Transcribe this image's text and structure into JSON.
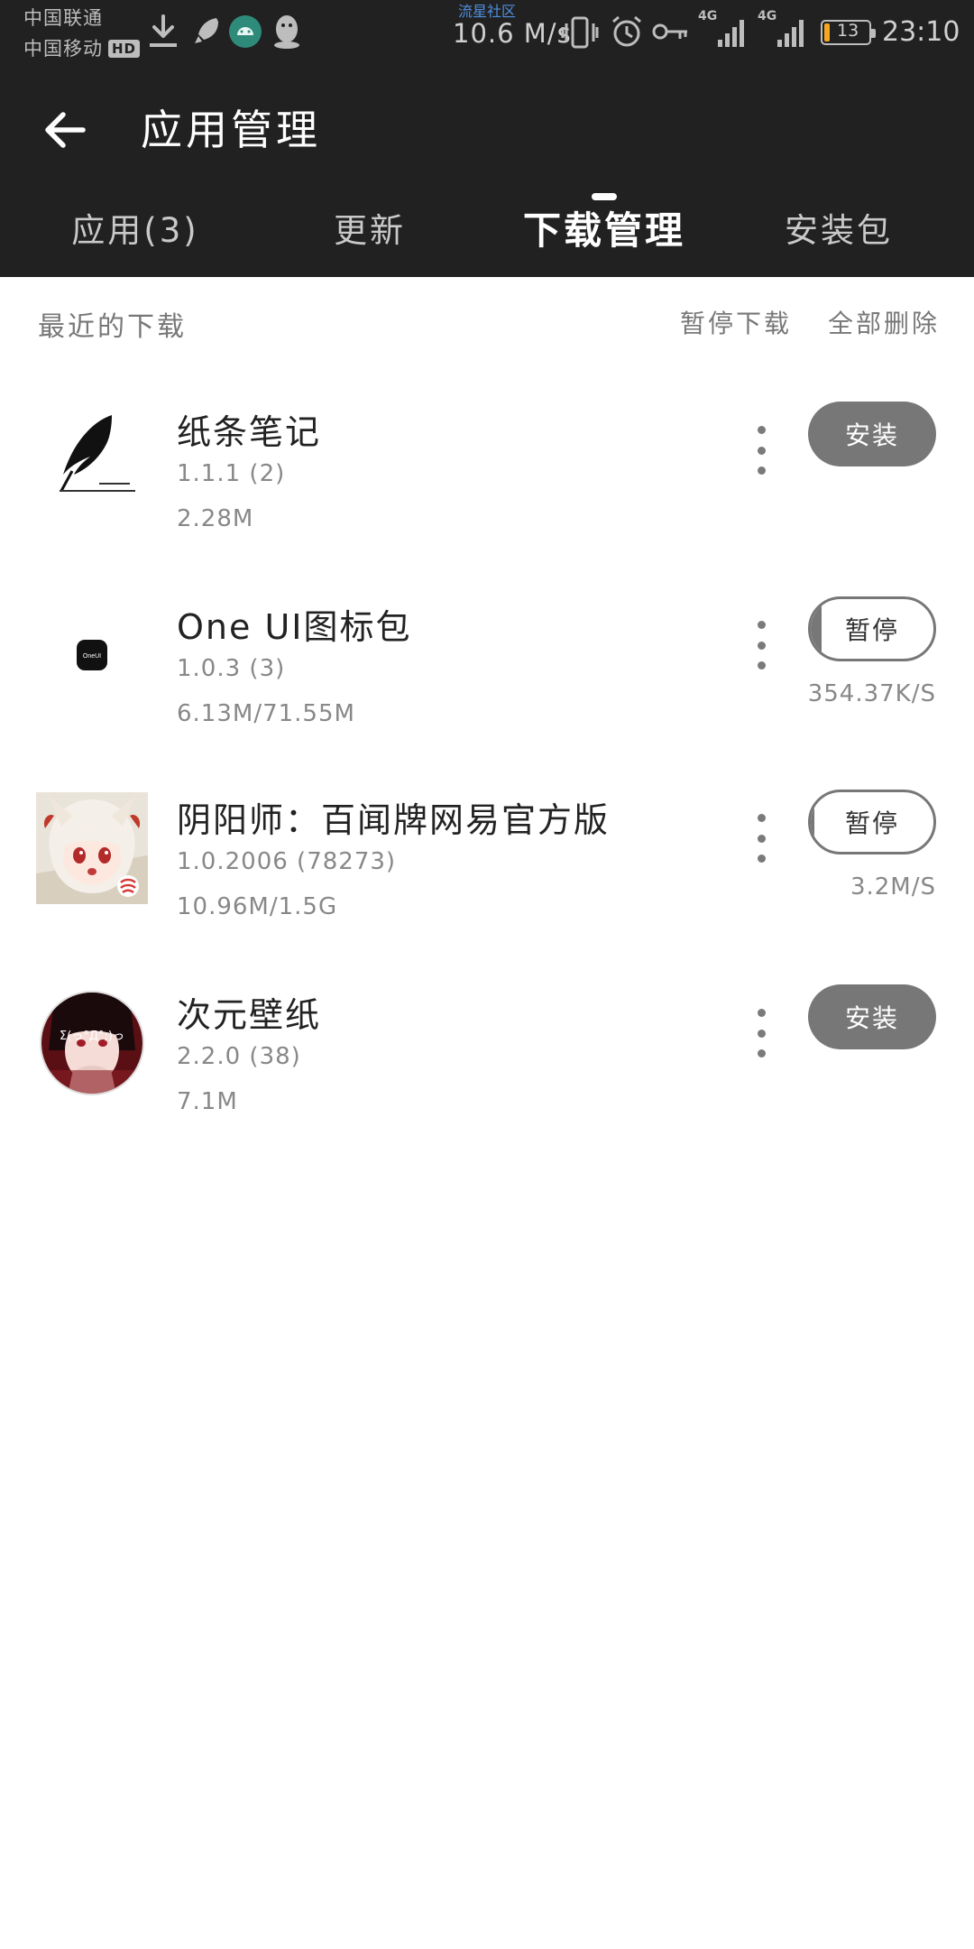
{
  "status_bar": {
    "carrier1": "中国联通",
    "carrier2": "中国移动",
    "hd_badge": "HD",
    "community": "流星社区",
    "network_speed": "10.6 M/s",
    "signal1_label": "4G",
    "signal2_label": "4G",
    "battery_level": "13",
    "battery_fraction": 0.13,
    "battery_color": "#f5a623",
    "time": "23:10"
  },
  "header": {
    "title": "应用管理",
    "back_icon": "arrow-left-icon"
  },
  "tabs": [
    {
      "label": "应用(3)",
      "active": false
    },
    {
      "label": "更新",
      "active": false
    },
    {
      "label": "下载管理",
      "active": true
    },
    {
      "label": "安装包",
      "active": false
    }
  ],
  "section": {
    "title": "最近的下载",
    "pause_all": "暂停下载",
    "delete_all": "全部删除"
  },
  "downloads": [
    {
      "name": "纸条笔记",
      "version": "1.1.1 (2)",
      "size": "2.28M",
      "action": "安装",
      "state": "install",
      "speed": "",
      "icon": "quill-icon"
    },
    {
      "name": "One UI图标包",
      "version": "1.0.3 (3)",
      "size": "6.13M/71.55M",
      "action": "暂停",
      "state": "downloading",
      "progress": 0.086,
      "speed": "354.37K/S",
      "icon": "oneui-icon",
      "icon_text": "OneUI"
    },
    {
      "name": "阴阳师：百闻牌网易官方版",
      "version": "1.0.2006 (78273)",
      "size": "10.96M/1.5G",
      "action": "暂停",
      "state": "downloading",
      "progress": 0.007,
      "speed": "3.2M/S",
      "icon": "anime-character-icon"
    },
    {
      "name": "次元壁纸",
      "version": "2.2.0 (38)",
      "size": "7.1M",
      "action": "安装",
      "state": "install",
      "speed": "",
      "icon": "anime-avatar-icon",
      "icon_text": "Σ(っ°Д°;)っ"
    }
  ],
  "colors": {
    "bar_bg": "#212121",
    "button_gray": "#777777",
    "text_gray": "#888888",
    "accent_blue": "#4f8fe0"
  }
}
